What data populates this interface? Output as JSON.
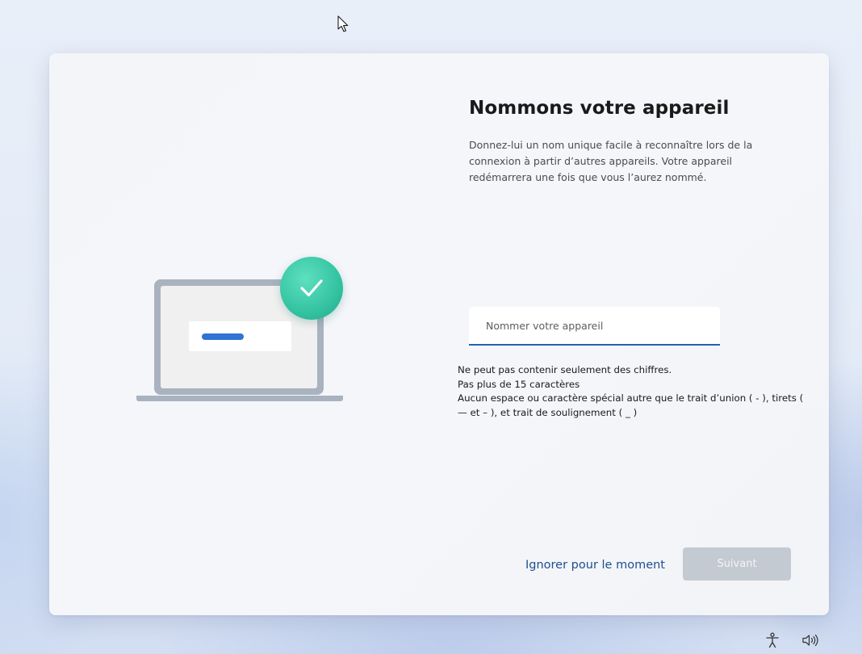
{
  "page": {
    "title": "Nommons votre appareil",
    "description": "Donnez-lui un nom unique facile à reconnaître lors de la connexion à partir d’autres appareils. Votre appareil redémarrera une fois que vous l’aurez nommé."
  },
  "name_input": {
    "placeholder": "Nommer votre appareil",
    "value": ""
  },
  "rules": [
    "Ne peut pas contenir seulement des chiffres.",
    "Pas plus de 15 caractères",
    "Aucun espace ou caractère spécial autre que le trait d’union ( - ), tirets ( — et – ), et trait de soulignement ( _ )"
  ],
  "actions": {
    "skip_label": "Ignorer pour le moment",
    "next_label": "Suivant"
  },
  "colors": {
    "accent": "#1f62b3",
    "link": "#1f4f8f",
    "check_badge": "#34c3a2",
    "laptop_frame": "#a9b3bf",
    "screen_bar": "#2f73d3",
    "disabled_button": "#c4cad2"
  },
  "icons": {
    "cursor": "mouse-pointer-icon",
    "check": "checkmark-icon",
    "accessibility": "accessibility-icon",
    "volume": "volume-icon"
  }
}
